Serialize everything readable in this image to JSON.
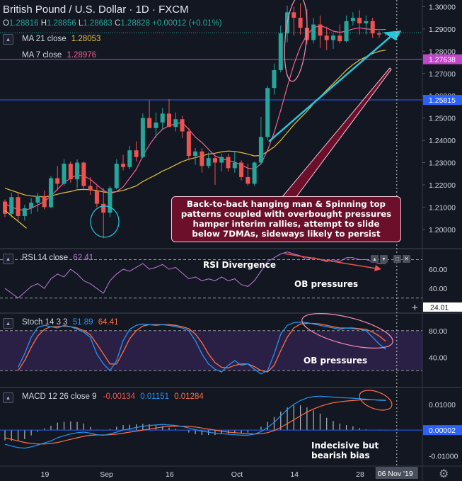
{
  "header": {
    "title": "British Pound / U.S. Dollar · 1D · FXCM",
    "ohlc": {
      "o_label": "O",
      "o": "1.28816",
      "h_label": "H",
      "h": "1.28856",
      "l_label": "L",
      "l": "1.28683",
      "c_label": "C",
      "c": "1.28828",
      "chg": "+0.00012 (+0.01%)"
    },
    "ma21": {
      "label": "MA  21 close",
      "value": "1.28053",
      "color": "#e5c03f"
    },
    "ma7": {
      "label": "MA  7 close",
      "value": "1.28976",
      "color": "#f06292"
    }
  },
  "colors": {
    "background": "#131722",
    "up": "#26a69a",
    "down": "#ef5350",
    "rsi_line": "#c07ad9",
    "stoch_k": "#2196f3",
    "stoch_d": "#ff7043",
    "macd": "#2196f3",
    "signal": "#ff7043",
    "hist": "#b2b5be",
    "hline_price": "#c047c9",
    "hline_blue": "#2962ff",
    "arrow": "#26c6da",
    "annotation_bg": "#6b0f2a"
  },
  "chart_data": {
    "type": "candlestick",
    "symbol": "British Pound / U.S. Dollar",
    "interval": "1D",
    "source": "FXCM",
    "price_axis": {
      "range": [
        1.192,
        1.303
      ],
      "ticks": [
        1.2,
        1.21,
        1.22,
        1.23,
        1.24,
        1.25,
        1.26,
        1.27,
        1.28,
        1.29,
        1.3
      ],
      "tick_labels": [
        "1.20000",
        "1.21000",
        "1.22000",
        "1.23000",
        "1.24000",
        "1.25000",
        "1.26000",
        "1.27000",
        "1.28000",
        "1.29000",
        "1.30000"
      ]
    },
    "x_axis": {
      "labels": [
        {
          "text": "19",
          "index": 6
        },
        {
          "text": "Sep",
          "index": 15
        },
        {
          "text": "16",
          "index": 25
        },
        {
          "text": "Oct",
          "index": 35
        },
        {
          "text": "14",
          "index": 44
        },
        {
          "text": "28",
          "index": 54
        },
        {
          "text": "No",
          "index": 58
        }
      ],
      "cursor_label": "06 Nov '19",
      "cursor_index": 60
    },
    "candles": [
      [
        1.2125,
        1.2135,
        1.2055,
        1.207
      ],
      [
        1.207,
        1.2165,
        1.2055,
        1.2145
      ],
      [
        1.2145,
        1.2165,
        1.204,
        1.206
      ],
      [
        1.206,
        1.211,
        1.204,
        1.2095
      ],
      [
        1.2095,
        1.214,
        1.207,
        1.212
      ],
      [
        1.212,
        1.2165,
        1.208,
        1.215
      ],
      [
        1.215,
        1.2175,
        1.209,
        1.21
      ],
      [
        1.21,
        1.224,
        1.2095,
        1.223
      ],
      [
        1.223,
        1.2285,
        1.2175,
        1.2205
      ],
      [
        1.2205,
        1.2315,
        1.2195,
        1.2295
      ],
      [
        1.2295,
        1.2305,
        1.221,
        1.2225
      ],
      [
        1.2225,
        1.2315,
        1.2185,
        1.23
      ],
      [
        1.23,
        1.2305,
        1.2175,
        1.2195
      ],
      [
        1.2195,
        1.2235,
        1.2155,
        1.2175
      ],
      [
        1.2175,
        1.2195,
        1.21,
        1.2115
      ],
      [
        1.2115,
        1.2185,
        1.196,
        1.2075
      ],
      [
        1.2075,
        1.2195,
        1.2055,
        1.2185
      ],
      [
        1.2185,
        1.2315,
        1.218,
        1.2295
      ],
      [
        1.2295,
        1.2335,
        1.2265,
        1.228
      ],
      [
        1.228,
        1.2375,
        1.227,
        1.2355
      ],
      [
        1.2355,
        1.2395,
        1.2305,
        1.2325
      ],
      [
        1.2325,
        1.252,
        1.232,
        1.25
      ],
      [
        1.25,
        1.258,
        1.248,
        1.2455
      ],
      [
        1.2455,
        1.2525,
        1.241,
        1.248
      ],
      [
        1.248,
        1.2545,
        1.245,
        1.252
      ],
      [
        1.252,
        1.2585,
        1.25,
        1.246
      ],
      [
        1.246,
        1.2525,
        1.244,
        1.2495
      ],
      [
        1.2495,
        1.251,
        1.241,
        1.244
      ],
      [
        1.244,
        1.2455,
        1.231,
        1.233
      ],
      [
        1.233,
        1.2365,
        1.229,
        1.235
      ],
      [
        1.235,
        1.2365,
        1.2255,
        1.2285
      ],
      [
        1.2285,
        1.2345,
        1.2275,
        1.232
      ],
      [
        1.232,
        1.2335,
        1.22,
        1.23
      ],
      [
        1.23,
        1.234,
        1.226,
        1.2325
      ],
      [
        1.2325,
        1.234,
        1.226,
        1.2275
      ],
      [
        1.2275,
        1.235,
        1.2255,
        1.23
      ],
      [
        1.23,
        1.231,
        1.222,
        1.2235
      ],
      [
        1.2235,
        1.2295,
        1.2195,
        1.2205
      ],
      [
        1.2205,
        1.2305,
        1.2195,
        1.23
      ],
      [
        1.23,
        1.2505,
        1.229,
        1.2415
      ],
      [
        1.2415,
        1.2645,
        1.24,
        1.2635
      ],
      [
        1.2635,
        1.2745,
        1.2605,
        1.2715
      ],
      [
        1.2715,
        1.2915,
        1.2705,
        1.288
      ],
      [
        1.288,
        1.3005,
        1.284,
        1.2975
      ],
      [
        1.2975,
        1.3,
        1.287,
        1.295
      ],
      [
        1.295,
        1.3015,
        1.2875,
        1.2905
      ],
      [
        1.2905,
        1.299,
        1.283,
        1.285
      ],
      [
        1.285,
        1.295,
        1.2835,
        1.292
      ],
      [
        1.292,
        1.296,
        1.2815,
        1.287
      ],
      [
        1.287,
        1.291,
        1.2805,
        1.285
      ],
      [
        1.285,
        1.288,
        1.281,
        1.287
      ],
      [
        1.287,
        1.292,
        1.2835,
        1.2845
      ],
      [
        1.2845,
        1.296,
        1.284,
        1.2935
      ],
      [
        1.2935,
        1.2975,
        1.2915,
        1.295
      ],
      [
        1.295,
        1.2985,
        1.2875,
        1.2925
      ],
      [
        1.2925,
        1.296,
        1.2875,
        1.2935
      ],
      [
        1.2935,
        1.295,
        1.286,
        1.288
      ],
      [
        1.288,
        1.289,
        1.286,
        1.2875
      ],
      [
        1.2882,
        1.2886,
        1.2868,
        1.2883
      ]
    ],
    "ma21_values": [
      1.2185,
      1.2175,
      1.2165,
      1.2155,
      1.215,
      1.2148,
      1.2146,
      1.215,
      1.2158,
      1.2165,
      1.217,
      1.2178,
      1.218,
      1.2178,
      1.2175,
      1.2168,
      1.2165,
      1.217,
      1.2175,
      1.2185,
      1.2195,
      1.2215,
      1.223,
      1.2245,
      1.2262,
      1.2275,
      1.229,
      1.2305,
      1.2315,
      1.2322,
      1.233,
      1.2338,
      1.2342,
      1.2348,
      1.2352,
      1.235,
      1.2345,
      1.2338,
      1.233,
      1.2332,
      1.235,
      1.237,
      1.24,
      1.2435,
      1.247,
      1.25,
      1.253,
      1.2565,
      1.2595,
      1.2625,
      1.2655,
      1.2685,
      1.2715,
      1.274,
      1.276,
      1.2775,
      1.279,
      1.28,
      1.2805
    ],
    "ma7_values": [
      1.2115,
      1.21,
      1.209,
      1.2085,
      1.2095,
      1.211,
      1.2125,
      1.215,
      1.218,
      1.221,
      1.223,
      1.2245,
      1.224,
      1.2225,
      1.22,
      1.2175,
      1.216,
      1.217,
      1.219,
      1.223,
      1.227,
      1.233,
      1.238,
      1.242,
      1.245,
      1.2465,
      1.2475,
      1.248,
      1.245,
      1.2415,
      1.239,
      1.236,
      1.233,
      1.2318,
      1.231,
      1.2302,
      1.229,
      1.2275,
      1.227,
      1.2295,
      1.2355,
      1.2435,
      1.2535,
      1.264,
      1.274,
      1.282,
      1.2875,
      1.2905,
      1.2915,
      1.2905,
      1.289,
      1.2885,
      1.289,
      1.29,
      1.2905,
      1.29,
      1.2898,
      1.2897,
      1.2898
    ],
    "price_labels": [
      {
        "value": "1.27638",
        "level": 1.27638,
        "color": "#c047c9"
      },
      {
        "value": "1.25815",
        "level": 1.25815,
        "color": "#2962ff"
      }
    ],
    "rsi": {
      "label": "RSI  14 close",
      "value": "62.41",
      "axis_ticks": [
        "60.00",
        "40.00"
      ],
      "range": [
        15,
        80
      ],
      "levels": [
        70,
        30
      ],
      "last_label": "24.01",
      "values": [
        40,
        35,
        30,
        36,
        42,
        45,
        40,
        50,
        55,
        52,
        60,
        55,
        48,
        45,
        40,
        35,
        48,
        55,
        60,
        58,
        62,
        66,
        60,
        62,
        65,
        60,
        62,
        56,
        50,
        52,
        48,
        50,
        48,
        52,
        48,
        50,
        44,
        42,
        48,
        58,
        68,
        72,
        76,
        78,
        76,
        74,
        70,
        72,
        70,
        68,
        70,
        68,
        72,
        72,
        70,
        70,
        68,
        66,
        66
      ]
    },
    "stoch": {
      "label": "Stoch  14 3 3",
      "k": "51.89",
      "d": "64.41",
      "axis_ticks": [
        "80.00",
        "40.00"
      ],
      "range": [
        0,
        100
      ],
      "levels": [
        80,
        20
      ],
      "k_values": [
        25,
        45,
        70,
        85,
        88,
        86,
        84,
        88,
        86,
        82,
        78,
        70,
        45,
        30,
        20,
        35,
        65,
        82,
        88,
        90,
        89,
        88,
        89,
        88,
        86,
        84,
        80,
        65,
        45,
        30,
        22,
        18,
        28,
        35,
        28,
        30,
        22,
        15,
        20,
        45,
        75,
        88,
        92,
        93,
        92,
        90,
        88,
        86,
        84,
        82,
        84,
        83,
        82,
        80,
        70,
        60,
        52
      ],
      "d_values": [
        20,
        35,
        55,
        72,
        82,
        86,
        86,
        87,
        86,
        84,
        80,
        74,
        60,
        45,
        30,
        30,
        48,
        68,
        80,
        87,
        89,
        89,
        89,
        89,
        88,
        86,
        83,
        75,
        62,
        45,
        32,
        25,
        24,
        28,
        30,
        30,
        26,
        20,
        18,
        28,
        50,
        70,
        84,
        90,
        91,
        91,
        90,
        88,
        86,
        84,
        84,
        84,
        83,
        82,
        78,
        72,
        64
      ]
    },
    "macd": {
      "label": "MACD  12 26 close 9",
      "macd_value": "-0.00134",
      "signal_value": "0.01151",
      "hist_value": "0.01284",
      "axis_ticks": [
        "0.01000",
        "-0.01000"
      ],
      "range": [
        -0.014,
        0.016
      ],
      "last_label": "0.00002",
      "macd_values": [
        -0.0055,
        -0.0062,
        -0.0068,
        -0.007,
        -0.0065,
        -0.0058,
        -0.005,
        -0.0042,
        -0.003,
        -0.0022,
        -0.0015,
        -0.001,
        -0.0008,
        -0.0012,
        -0.0018,
        -0.002,
        -0.0015,
        -0.0008,
        0.0,
        0.0005,
        0.001,
        0.0015,
        0.0018,
        0.002,
        0.0022,
        0.002,
        0.0018,
        0.0014,
        0.0008,
        0.0002,
        -0.0004,
        -0.0008,
        -0.0012,
        -0.0014,
        -0.0016,
        -0.0018,
        -0.002,
        -0.002,
        -0.0016,
        -0.0006,
        0.001,
        0.003,
        0.0055,
        0.008,
        0.01,
        0.0115,
        0.0125,
        0.013,
        0.0132,
        0.013,
        0.0128,
        0.0126,
        0.0125,
        0.0124,
        0.0122,
        0.012,
        0.0118,
        0.0116,
        0.0115
      ],
      "signal_values": [
        -0.003,
        -0.0036,
        -0.0042,
        -0.0048,
        -0.0052,
        -0.0054,
        -0.0054,
        -0.0052,
        -0.0048,
        -0.0042,
        -0.0036,
        -0.003,
        -0.0024,
        -0.002,
        -0.0019,
        -0.0019,
        -0.0018,
        -0.0016,
        -0.0012,
        -0.0008,
        -0.0004,
        0.0,
        0.0004,
        0.0008,
        0.0012,
        0.0014,
        0.0015,
        0.0015,
        0.0014,
        0.0012,
        0.0008,
        0.0004,
        0.0,
        -0.0004,
        -0.0008,
        -0.001,
        -0.0012,
        -0.0014,
        -0.0015,
        -0.0014,
        -0.001,
        -0.0002,
        0.001,
        0.0025,
        0.004,
        0.0055,
        0.007,
        0.0082,
        0.0092,
        0.01,
        0.0106,
        0.011,
        0.0113,
        0.0115,
        0.0117,
        0.0118,
        0.0118,
        0.0117,
        0.0116
      ]
    }
  },
  "annotations": {
    "main_box": "Back-to-back hanging man & Spinning top patterns coupled with overbought pressures hamper interim rallies, attempt to slide below 7DMAs, sideways likely to persist",
    "main_box_lines": [
      "Back-to-back hanging man & Spinning top",
      "patterns coupled with overbought pressures",
      "hamper interim rallies, attempt to slide",
      "below 7DMAs, sideways likely to persist"
    ],
    "rsi_divergence": "RSI Divergence",
    "rsi_ob": "OB pressures",
    "stoch_ob": "OB pressures",
    "macd_note_1": "Indecisive but",
    "macd_note_2": "bearish bias"
  },
  "icons": {
    "collapse": "chevron-up-icon",
    "settings": "gear-icon",
    "crosshair": "plus-icon"
  }
}
